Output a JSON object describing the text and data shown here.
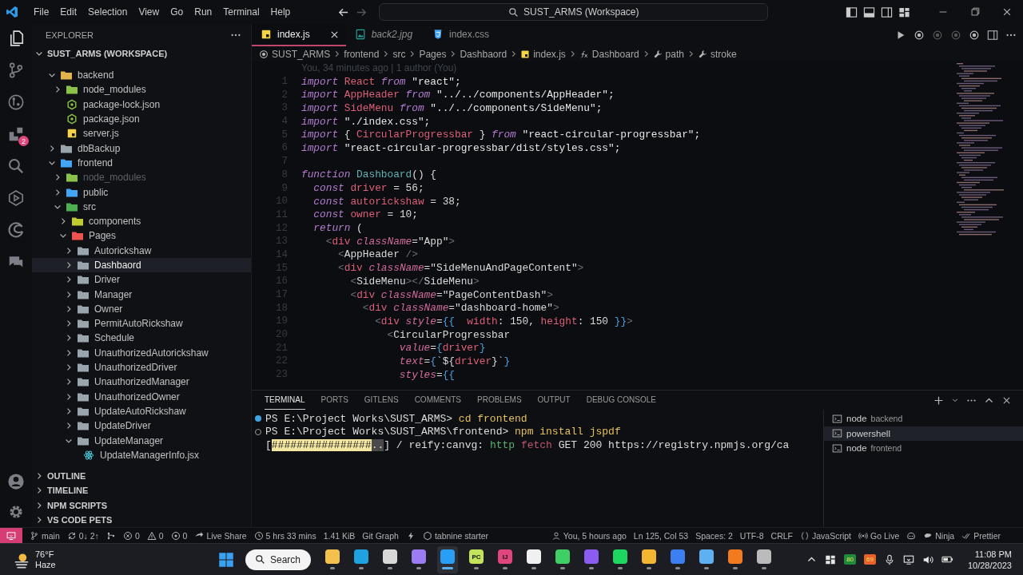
{
  "title_bar": {
    "menu": [
      "File",
      "Edit",
      "Selection",
      "View",
      "Go",
      "Run",
      "Terminal",
      "Help"
    ],
    "command_center": "SUST_ARMS (Workspace)"
  },
  "activity_bar": {
    "items": [
      {
        "kind": "explorer",
        "selected": true
      },
      {
        "kind": "source-control",
        "selected": false
      },
      {
        "kind": "gitlens",
        "selected": false
      },
      {
        "kind": "extensions",
        "selected": false,
        "badge": "2"
      },
      {
        "kind": "search",
        "selected": false
      },
      {
        "kind": "run",
        "selected": false
      },
      {
        "kind": "browser",
        "selected": false
      },
      {
        "kind": "chat",
        "selected": false
      }
    ]
  },
  "sidebar": {
    "title": "EXPLORER",
    "workspace": "SUST_ARMS (WORKSPACE)",
    "tree": [
      {
        "label": "backend",
        "kind": "folder",
        "color": "#e2b34a",
        "expanded": true,
        "selected": false,
        "ignored": false,
        "children": [
          {
            "label": "node_modules",
            "kind": "folder",
            "color": "#8bc34a",
            "expanded": false,
            "selected": false,
            "ignored": false
          },
          {
            "label": "package-lock.json",
            "kind": "json",
            "selected": false,
            "ignored": false
          },
          {
            "label": "package.json",
            "kind": "json",
            "selected": false,
            "ignored": false
          },
          {
            "label": "server.js",
            "kind": "js",
            "selected": false,
            "ignored": false
          }
        ]
      },
      {
        "label": "dbBackup",
        "kind": "folder",
        "color": "#9aa4ad",
        "expanded": false,
        "selected": false,
        "ignored": false
      },
      {
        "label": "frontend",
        "kind": "folder",
        "color": "#42a5f5",
        "expanded": true,
        "selected": false,
        "ignored": false,
        "children": [
          {
            "label": "node_modules",
            "kind": "folder",
            "color": "#8bc34a",
            "expanded": false,
            "selected": false,
            "ignored": true
          },
          {
            "label": "public",
            "kind": "folder",
            "color": "#42a5f5",
            "expanded": false,
            "selected": false,
            "ignored": false
          },
          {
            "label": "src",
            "kind": "folder",
            "color": "#4caf50",
            "expanded": true,
            "selected": false,
            "ignored": false,
            "children": [
              {
                "label": "components",
                "kind": "folder",
                "color": "#c0ca33",
                "expanded": false,
                "selected": false,
                "ignored": false
              },
              {
                "label": "Pages",
                "kind": "folder",
                "color": "#ef5350",
                "expanded": true,
                "selected": false,
                "ignored": false,
                "children": [
                  {
                    "label": "Autorickshaw",
                    "kind": "folder",
                    "color": "#9aa4ad",
                    "expanded": false,
                    "selected": false,
                    "ignored": false
                  },
                  {
                    "label": "Dashbaord",
                    "kind": "folder",
                    "color": "#9aa4ad",
                    "expanded": false,
                    "selected": true,
                    "ignored": false
                  },
                  {
                    "label": "Driver",
                    "kind": "folder",
                    "color": "#9aa4ad",
                    "expanded": false,
                    "selected": false,
                    "ignored": false
                  },
                  {
                    "label": "Manager",
                    "kind": "folder",
                    "color": "#9aa4ad",
                    "expanded": false,
                    "selected": false,
                    "ignored": false
                  },
                  {
                    "label": "Owner",
                    "kind": "folder",
                    "color": "#9aa4ad",
                    "expanded": false,
                    "selected": false,
                    "ignored": false
                  },
                  {
                    "label": "PermitAutoRickshaw",
                    "kind": "folder",
                    "color": "#9aa4ad",
                    "expanded": false,
                    "selected": false,
                    "ignored": false
                  },
                  {
                    "label": "Schedule",
                    "kind": "folder",
                    "color": "#9aa4ad",
                    "expanded": false,
                    "selected": false,
                    "ignored": false
                  },
                  {
                    "label": "UnauthorizedAutorickshaw",
                    "kind": "folder",
                    "color": "#9aa4ad",
                    "expanded": false,
                    "selected": false,
                    "ignored": false
                  },
                  {
                    "label": "UnauthorizedDriver",
                    "kind": "folder",
                    "color": "#9aa4ad",
                    "expanded": false,
                    "selected": false,
                    "ignored": false
                  },
                  {
                    "label": "UnauthorizedManager",
                    "kind": "folder",
                    "color": "#9aa4ad",
                    "expanded": false,
                    "selected": false,
                    "ignored": false
                  },
                  {
                    "label": "UnauthorizedOwner",
                    "kind": "folder",
                    "color": "#9aa4ad",
                    "expanded": false,
                    "selected": false,
                    "ignored": false
                  },
                  {
                    "label": "UpdateAutoRickshaw",
                    "kind": "folder",
                    "color": "#9aa4ad",
                    "expanded": false,
                    "selected": false,
                    "ignored": false
                  },
                  {
                    "label": "UpdateDriver",
                    "kind": "folder",
                    "color": "#9aa4ad",
                    "expanded": false,
                    "selected": false,
                    "ignored": false
                  },
                  {
                    "label": "UpdateManager",
                    "kind": "folder",
                    "color": "#9aa4ad",
                    "expanded": true,
                    "selected": false,
                    "ignored": false,
                    "children": [
                      {
                        "label": "UpdateManagerInfo.jsx",
                        "kind": "jsx",
                        "selected": false,
                        "ignored": false
                      }
                    ]
                  }
                ]
              }
            ]
          }
        ]
      }
    ],
    "sections": [
      "OUTLINE",
      "TIMELINE",
      "NPM SCRIPTS",
      "VS CODE PETS"
    ]
  },
  "tabs": [
    {
      "label": "index.js",
      "kind": "js",
      "selected": true,
      "preview": false
    },
    {
      "label": "back2.jpg",
      "kind": "image",
      "selected": false,
      "preview": true
    },
    {
      "label": "index.css",
      "kind": "css",
      "selected": false,
      "preview": false
    }
  ],
  "breadcrumb": [
    {
      "label": "SUST_ARMS",
      "kind": "root"
    },
    {
      "label": "frontend",
      "kind": "plain"
    },
    {
      "label": "src",
      "kind": "plain"
    },
    {
      "label": "Pages",
      "kind": "plain"
    },
    {
      "label": "Dashbaord",
      "kind": "plain"
    },
    {
      "label": "index.js",
      "kind": "js"
    },
    {
      "label": "Dashboard",
      "kind": "function"
    },
    {
      "label": "path",
      "kind": "property"
    },
    {
      "label": "stroke",
      "kind": "property"
    }
  ],
  "editor": {
    "blame": "You, 34 minutes ago | 1 author (You)",
    "lines": [
      {
        "number": "1",
        "tokens": [
          {
            "kind": "kw",
            "text": "import"
          },
          {
            "kind": "name",
            "text": " React"
          },
          {
            "kind": "kw",
            "text": " from"
          },
          {
            "kind": "str",
            "text": " \"react\";"
          }
        ]
      },
      {
        "number": "2",
        "tokens": [
          {
            "kind": "kw",
            "text": "import"
          },
          {
            "kind": "name",
            "text": " AppHeader"
          },
          {
            "kind": "kw",
            "text": " from"
          },
          {
            "kind": "str",
            "text": " \"../../components/AppHeader\";"
          }
        ]
      },
      {
        "number": "3",
        "tokens": [
          {
            "kind": "kw",
            "text": "import"
          },
          {
            "kind": "name",
            "text": " SideMenu"
          },
          {
            "kind": "kw",
            "text": " from"
          },
          {
            "kind": "str",
            "text": " \"../../components/SideMenu\";"
          }
        ]
      },
      {
        "number": "4",
        "tokens": [
          {
            "kind": "kw",
            "text": "import"
          },
          {
            "kind": "str",
            "text": " \"./index.css\";"
          }
        ]
      },
      {
        "number": "5",
        "tokens": [
          {
            "kind": "kw",
            "text": "import"
          },
          {
            "kind": "punct",
            "text": " {"
          },
          {
            "kind": "name",
            "text": " CircularProgressbar"
          },
          {
            "kind": "punct",
            "text": " }"
          },
          {
            "kind": "kw",
            "text": " from"
          },
          {
            "kind": "str",
            "text": " \"react-circular-progressbar\";"
          }
        ]
      },
      {
        "number": "6",
        "tokens": [
          {
            "kind": "kw",
            "text": "import"
          },
          {
            "kind": "str",
            "text": " \"react-circular-progressbar/dist/styles.css\";"
          }
        ]
      },
      {
        "number": "7"
      },
      {
        "number": "8",
        "tokens": [
          {
            "kind": "kw",
            "text": "function"
          },
          {
            "kind": "fn",
            "text": " Dashboard"
          },
          {
            "kind": "punct",
            "text": "() {"
          }
        ]
      },
      {
        "number": "9",
        "tokens": [
          {
            "kind": "kw",
            "text": "  const"
          },
          {
            "kind": "name",
            "text": " driver"
          },
          {
            "kind": "punct",
            "text": " = 56;"
          }
        ]
      },
      {
        "number": "10",
        "tokens": [
          {
            "kind": "kw",
            "text": "  const"
          },
          {
            "kind": "name",
            "text": " autorickshaw"
          },
          {
            "kind": "punct",
            "text": " = 38;"
          }
        ]
      },
      {
        "number": "11",
        "tokens": [
          {
            "kind": "kw",
            "text": "  const"
          },
          {
            "kind": "name",
            "text": " owner"
          },
          {
            "kind": "punct",
            "text": " = 10;"
          }
        ]
      },
      {
        "number": "12",
        "tokens": [
          {
            "kind": "kw",
            "text": "  return"
          },
          {
            "kind": "punct",
            "text": " ("
          }
        ]
      },
      {
        "number": "13",
        "tokens": [
          {
            "kind": "bracket",
            "text": "    <"
          },
          {
            "kind": "tag",
            "text": "div"
          },
          {
            "kind": "attr",
            "text": " className"
          },
          {
            "kind": "punct",
            "text": "=\"App\""
          },
          {
            "kind": "bracket",
            "text": ">"
          }
        ]
      },
      {
        "number": "14",
        "tokens": [
          {
            "kind": "bracket",
            "text": "      <"
          },
          {
            "kind": "punct",
            "text": "AppHeader"
          },
          {
            "kind": "bracket",
            "text": " />"
          }
        ]
      },
      {
        "number": "15",
        "tokens": [
          {
            "kind": "bracket",
            "text": "      <"
          },
          {
            "kind": "tag",
            "text": "div"
          },
          {
            "kind": "attr",
            "text": " className"
          },
          {
            "kind": "punct",
            "text": "=\"SideMenuAndPageContent\""
          },
          {
            "kind": "bracket",
            "text": ">"
          }
        ]
      },
      {
        "number": "16",
        "tokens": [
          {
            "kind": "bracket",
            "text": "        <"
          },
          {
            "kind": "punct",
            "text": "SideMenu"
          },
          {
            "kind": "bracket",
            "text": "></"
          },
          {
            "kind": "punct",
            "text": "SideMenu"
          },
          {
            "kind": "bracket",
            "text": ">"
          }
        ]
      },
      {
        "number": "17",
        "tokens": [
          {
            "kind": "bracket",
            "text": "        <"
          },
          {
            "kind": "tag",
            "text": "div"
          },
          {
            "kind": "attr",
            "text": " className"
          },
          {
            "kind": "punct",
            "text": "=\"PageContentDash\""
          },
          {
            "kind": "bracket",
            "text": ">"
          }
        ]
      },
      {
        "number": "18",
        "tokens": [
          {
            "kind": "bracket",
            "text": "          <"
          },
          {
            "kind": "tag",
            "text": "div"
          },
          {
            "kind": "attr",
            "text": " className"
          },
          {
            "kind": "punct",
            "text": "=\"dashboard-home\""
          },
          {
            "kind": "bracket",
            "text": ">"
          }
        ]
      },
      {
        "number": "19",
        "tokens": [
          {
            "kind": "bracket",
            "text": "            <"
          },
          {
            "kind": "tag",
            "text": "div"
          },
          {
            "kind": "attr",
            "text": " style"
          },
          {
            "kind": "punct",
            "text": "="
          },
          {
            "kind": "brace",
            "text": "{{"
          },
          {
            "kind": "name",
            "text": "  width"
          },
          {
            "kind": "punct",
            "text": ": 150,"
          },
          {
            "kind": "name",
            "text": " height"
          },
          {
            "kind": "punct",
            "text": ": 150 "
          },
          {
            "kind": "brace",
            "text": "}}"
          },
          {
            "kind": "bracket",
            "text": ">"
          }
        ]
      },
      {
        "number": "20",
        "tokens": [
          {
            "kind": "bracket",
            "text": "              <"
          },
          {
            "kind": "punct",
            "text": "CircularProgressbar"
          }
        ]
      },
      {
        "number": "21",
        "tokens": [
          {
            "kind": "attr",
            "text": "                value"
          },
          {
            "kind": "punct",
            "text": "="
          },
          {
            "kind": "brace",
            "text": "{"
          },
          {
            "kind": "name",
            "text": "driver"
          },
          {
            "kind": "brace",
            "text": "}"
          }
        ]
      },
      {
        "number": "22",
        "tokens": [
          {
            "kind": "attr",
            "text": "                text"
          },
          {
            "kind": "punct",
            "text": "="
          },
          {
            "kind": "brace",
            "text": "{"
          },
          {
            "kind": "punct",
            "text": "`${"
          },
          {
            "kind": "name",
            "text": "driver"
          },
          {
            "kind": "punct",
            "text": "}`"
          },
          {
            "kind": "brace",
            "text": "}"
          }
        ]
      },
      {
        "number": "23",
        "tokens": [
          {
            "kind": "attr",
            "text": "                styles"
          },
          {
            "kind": "punct",
            "text": "="
          },
          {
            "kind": "brace",
            "text": "{{"
          }
        ]
      }
    ]
  },
  "panel": {
    "tabs": [
      {
        "label": "TERMINAL",
        "selected": true
      },
      {
        "label": "PORTS",
        "selected": false
      },
      {
        "label": "GITLENS",
        "selected": false
      },
      {
        "label": "COMMENTS",
        "selected": false
      },
      {
        "label": "PROBLEMS",
        "selected": false
      },
      {
        "label": "OUTPUT",
        "selected": false
      },
      {
        "label": "DEBUG CONSOLE",
        "selected": false
      }
    ],
    "terminal": [
      {
        "kind": "done",
        "tokens": [
          {
            "kind": "text",
            "text": "PS E:\\Project Works\\SUST_ARMS> "
          },
          {
            "kind": "cmd",
            "text": "cd frontend"
          }
        ]
      },
      {
        "kind": "running",
        "tokens": [
          {
            "kind": "text",
            "text": "PS E:\\Project Works\\SUST_ARMS\\frontend> "
          },
          {
            "kind": "cmd",
            "text": "npm install jspdf"
          }
        ]
      },
      {
        "kind": "output",
        "tokens": [
          {
            "kind": "text",
            "text": "["
          },
          {
            "kind": "progress",
            "text": "################"
          },
          {
            "kind": "pending",
            "text": ".."
          },
          {
            "kind": "text",
            "text": "] / reify:canvg: "
          },
          {
            "kind": "http",
            "text": "http"
          },
          {
            "kind": "fetch",
            "text": " fetch"
          },
          {
            "kind": "text",
            "text": " GET 200 https://registry.npmjs.org/ca"
          }
        ]
      }
    ],
    "terminals": [
      {
        "name": "node",
        "detail": "backend",
        "selected": false
      },
      {
        "name": "powershell",
        "selected": true
      },
      {
        "name": "node",
        "detail": "frontend",
        "selected": false
      }
    ]
  },
  "status_bar": {
    "left": [
      {
        "kind": "remote"
      },
      {
        "kind": "branch",
        "text": "main"
      },
      {
        "kind": "sync",
        "text": "0↓ 2↑"
      },
      {
        "kind": "graph"
      },
      {
        "kind": "error",
        "text": "0"
      },
      {
        "kind": "warning",
        "text": "0"
      },
      {
        "kind": "ports",
        "text": "0"
      },
      {
        "kind": "share",
        "text": "Live Share"
      },
      {
        "kind": "clock",
        "text": "5 hrs 33 mins"
      },
      {
        "kind": "plain",
        "text": "1.41 KiB"
      },
      {
        "kind": "plain",
        "text": "Git Graph"
      },
      {
        "kind": "bolt"
      },
      {
        "kind": "tabnine",
        "text": "tabnine starter"
      }
    ],
    "right": [
      {
        "kind": "blame",
        "text": "You, 5 hours ago"
      },
      {
        "kind": "plain",
        "text": "Ln 125, Col 53"
      },
      {
        "kind": "plain",
        "text": "Spaces: 2"
      },
      {
        "kind": "plain",
        "text": "UTF-8"
      },
      {
        "kind": "plain",
        "text": "CRLF"
      },
      {
        "kind": "braces",
        "text": "JavaScript"
      },
      {
        "kind": "broadcast",
        "text": "Go Live"
      },
      {
        "kind": "copilot"
      },
      {
        "kind": "ninja",
        "text": "Ninja"
      },
      {
        "kind": "check",
        "text": "Prettier"
      }
    ]
  },
  "taskbar": {
    "weather": {
      "temperature": "76°F",
      "condition": "Haze"
    },
    "search": "Search",
    "apps": [
      {
        "color": "#f2c14e",
        "selected": false
      },
      {
        "color": "#1fa3e0",
        "selected": false
      },
      {
        "color": "#d8d8d8",
        "selected": false
      },
      {
        "color": "#9b7cf2",
        "selected": false
      },
      {
        "color": "#2a9df4",
        "selected": true
      },
      {
        "color": "#c3e35a",
        "label": "PC",
        "selected": false
      },
      {
        "color": "#e0457b",
        "label": "IJ",
        "selected": false
      },
      {
        "color": "#f0f0f0",
        "selected": false
      },
      {
        "color": "#3fcf64",
        "selected": false
      },
      {
        "color": "#8a5cf0",
        "selected": false
      },
      {
        "color": "#1ed760",
        "selected": false
      },
      {
        "color": "#f2b632",
        "selected": false
      },
      {
        "color": "#3d7ff0",
        "selected": false
      },
      {
        "color": "#5fb0f0",
        "selected": false
      },
      {
        "color": "#f47a20",
        "selected": false
      },
      {
        "color": "#bbbbbb",
        "selected": false
      }
    ],
    "tray_badges": [
      {
        "text": "80",
        "color": "#1f8a3a"
      },
      {
        "text": "69",
        "color": "#e8612c"
      }
    ],
    "time": "11:08 PM",
    "date": "10/28/2023"
  }
}
